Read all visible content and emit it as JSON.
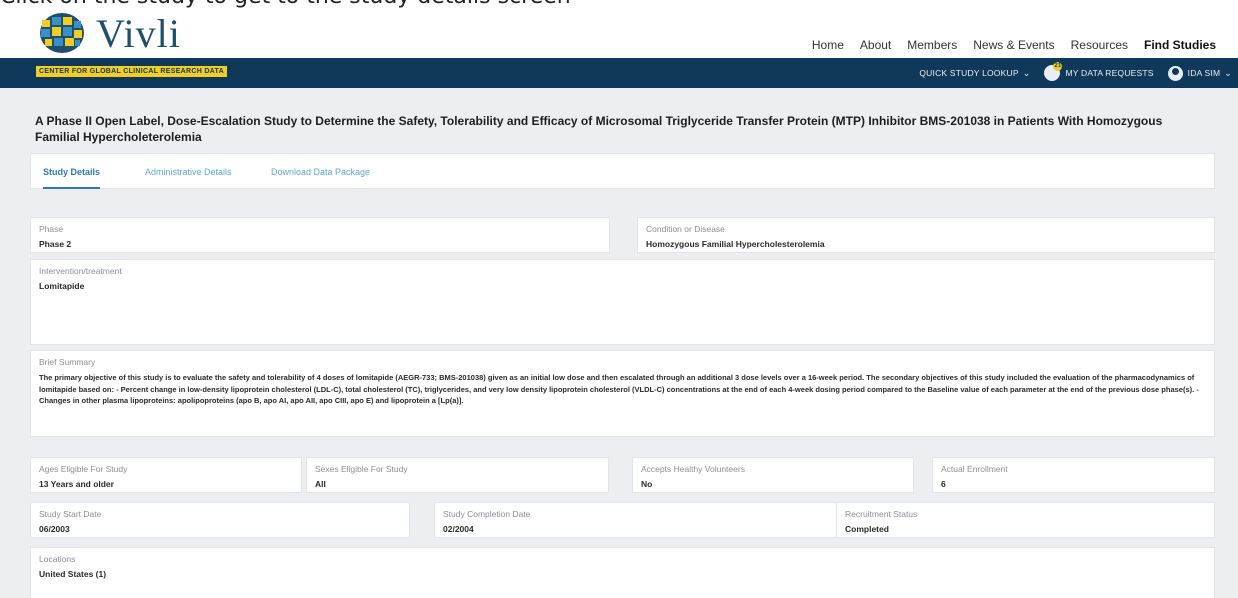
{
  "instruction": "Click on the study to get to the study details screen",
  "logo": {
    "text": "Vivli",
    "tagline": "CENTER FOR GLOBAL CLINICAL RESEARCH DATA"
  },
  "topnav": [
    "Home",
    "About",
    "Members",
    "News & Events",
    "Resources",
    "Find Studies"
  ],
  "bandnav": {
    "quick_lookup": "QUICK STUDY LOOKUP",
    "requests": "MY DATA REQUESTS",
    "requests_badge": "21",
    "user": "IDA SIM"
  },
  "study": {
    "title": "A Phase II Open Label, Dose-Escalation Study to Determine the Safety, Tolerability and Efficacy of Microsomal Triglyceride Transfer Protein (MTP) Inhibitor BMS-201038 in Patients With Homozygous Familial Hypercholeterolemia",
    "tabs": [
      "Study Details",
      "Administrative Details",
      "Download Data Package"
    ],
    "phase": {
      "label": "Phase",
      "value": "Phase 2"
    },
    "condition": {
      "label": "Condition or Disease",
      "value": "Homozygous Familial Hypercholesterolemia"
    },
    "intervention": {
      "label": "Intervention/treatment",
      "value": "Lomitapide"
    },
    "summary": {
      "label": "Brief Summary",
      "value": "The primary objective of this study is to evaluate the safety and tolerability of 4 doses of lomitapide (AEGR-733; BMS-201038) given as an initial low dose and then escalated through an additional 3 dose levels over a 16-week period. The secondary objectives of this study included the evaluation of the pharmacodynamics of lomitapide based on:  - Percent change in low-density lipoprotein cholesterol (LDL-C), total cholesterol (TC), triglycerides, and very low density lipoprotein cholesterol (VLDL-C) concentrations at the end of each 4-week dosing period compared to the Baseline value of each parameter at the end of the previous dose phase(s).  - Changes in other plasma lipoproteins: apolipoproteins (apo B, apo AI, apo AII, apo CIII, apo E) and lipoprotein a [Lp(a)]."
    },
    "ages": {
      "label": "Ages Eligible For Study",
      "value": "13 Years and older"
    },
    "sexes": {
      "label": "Sexes Eligible For Study",
      "value": "All"
    },
    "healthy": {
      "label": "Accepts Healthy Volunteers",
      "value": "No"
    },
    "enrollment": {
      "label": "Actual Enrollment",
      "value": "6"
    },
    "start": {
      "label": "Study Start Date",
      "value": "06/2003"
    },
    "completion": {
      "label": "Study Completion Date",
      "value": "02/2004"
    },
    "recruitment": {
      "label": "Recruitment Status",
      "value": "Completed"
    },
    "locations": {
      "label": "Locations",
      "value": "United States (1)"
    }
  }
}
